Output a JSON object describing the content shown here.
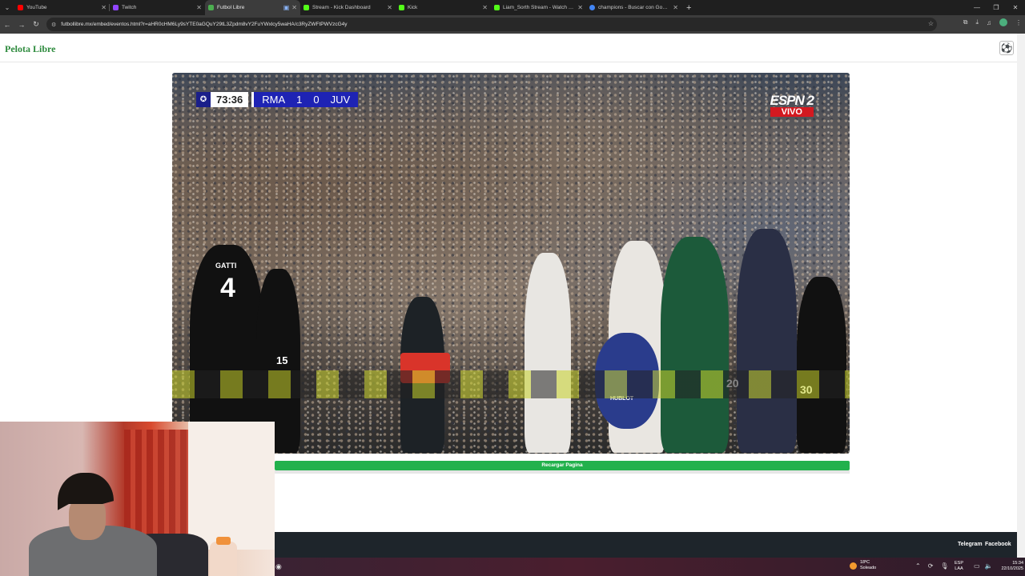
{
  "browser": {
    "tabs": [
      {
        "title": "YouTube",
        "favicon_color": "#ff0000",
        "active": false
      },
      {
        "title": "Twitch",
        "favicon_color": "#9146ff",
        "active": false
      },
      {
        "title": "Futbol Libre",
        "favicon_color": "#4caf50",
        "active": true
      },
      {
        "title": "Stream - Kick Dashboard",
        "favicon_color": "#53fc18",
        "active": false
      },
      {
        "title": "Kick",
        "favicon_color": "#53fc18",
        "active": false
      },
      {
        "title": "Liam_Sorth Stream - Watch Live",
        "favicon_color": "#53fc18",
        "active": false
      },
      {
        "title": "champions - Buscar con Google",
        "favicon_color": "#4285f4",
        "active": false
      }
    ],
    "url": "futbollibre.mx/embed/eventos.html?r=aHR0cHM6Ly9sYTE0aGQuY29tL3Zpdm8vY2FuYWxlcy5waHA/c3RyZWFtPWVzcG4y"
  },
  "page": {
    "brand": "Pelota Libre",
    "scorebug": {
      "time": "73:36",
      "home": "RMA",
      "home_score": "1",
      "away_score": "0",
      "away": "JUV"
    },
    "channel": {
      "name": "ESPN 2",
      "live_label": "VIVO"
    },
    "player_names": {
      "gatti_name": "GATTI",
      "gatti_number": "4",
      "p15": "15",
      "p20": "20",
      "p30": "30",
      "sponsor": "HUBLOT"
    },
    "reload_label": "Recargar Pagina",
    "footer": {
      "telegram": "Telegram",
      "facebook": "Facebook"
    }
  },
  "taskbar": {
    "weather_temp": "18ºC",
    "weather_text": "Soleado",
    "lang_top": "ESP",
    "lang_bottom": "LAA",
    "time": "15:34",
    "date": "22/10/2025"
  }
}
